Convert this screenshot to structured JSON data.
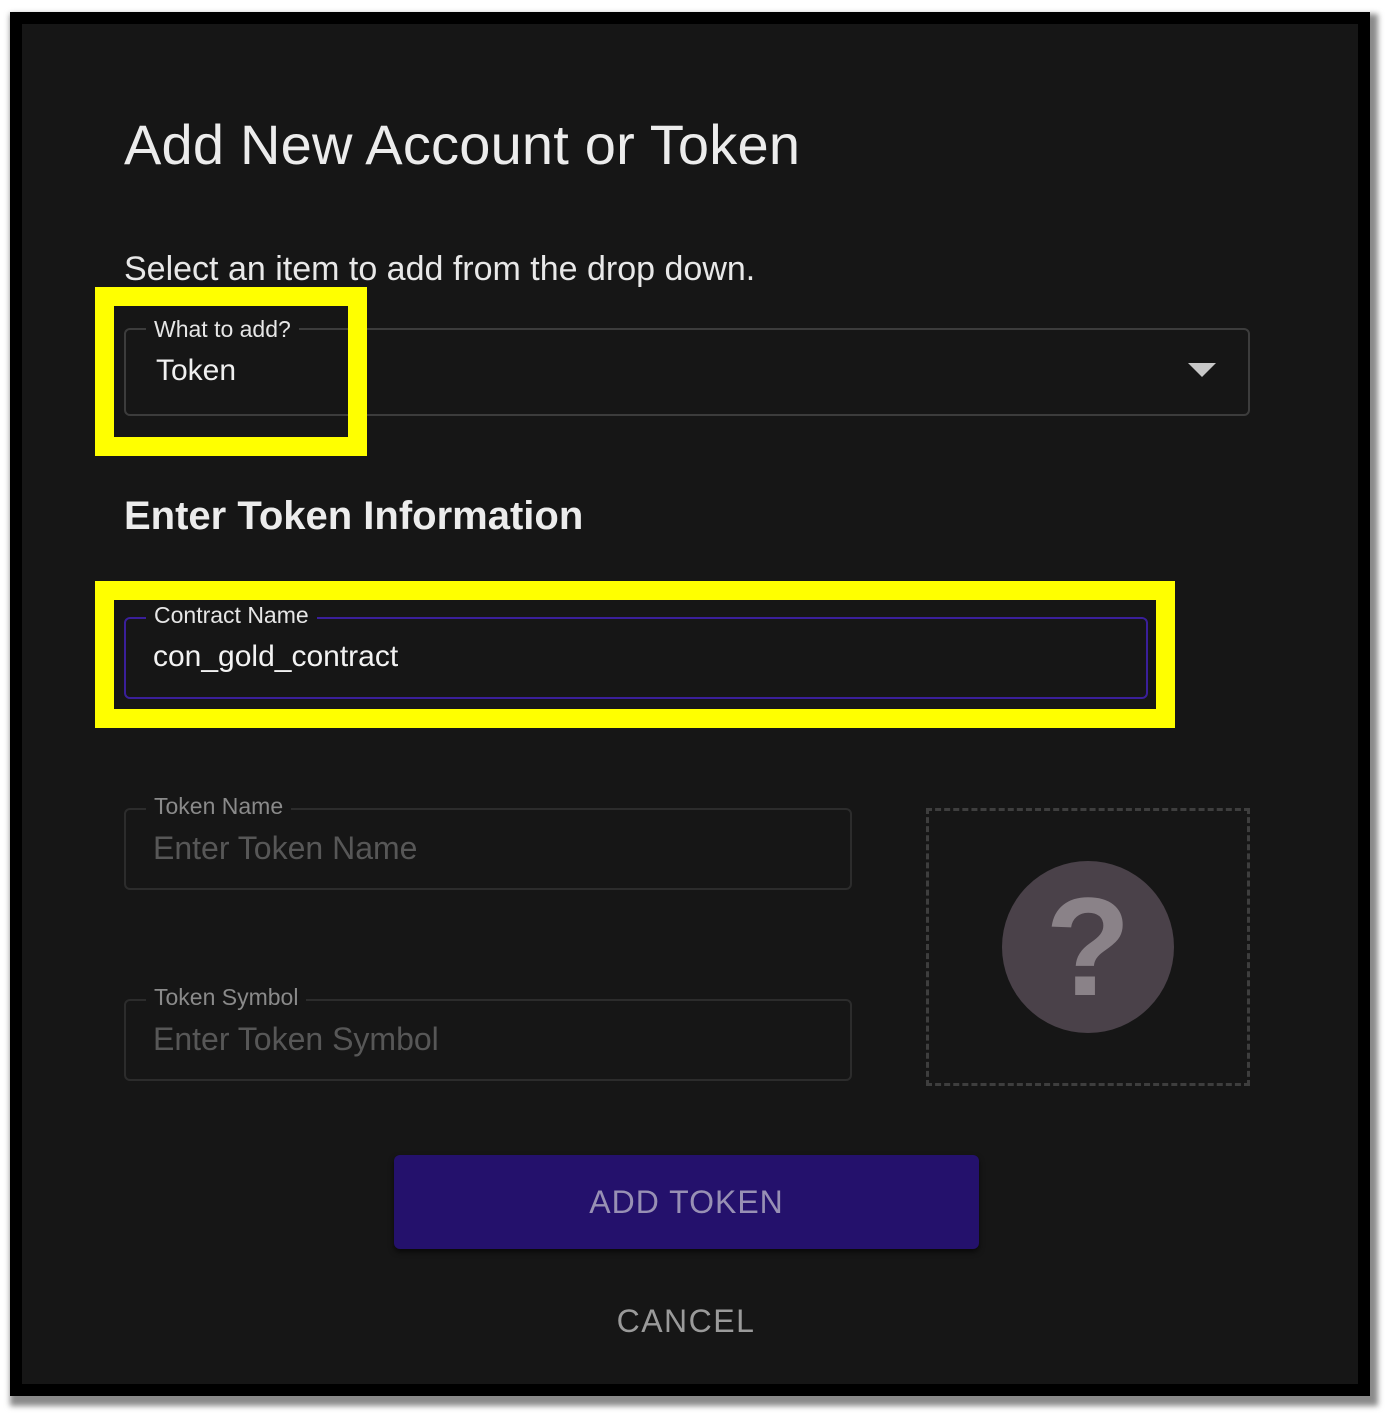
{
  "dialog": {
    "title": "Add New Account or Token",
    "instruction": "Select an item to add from the drop down."
  },
  "type_select": {
    "label": "What to add?",
    "value": "Token"
  },
  "section": {
    "heading": "Enter Token Information"
  },
  "contract_name": {
    "label": "Contract Name",
    "value": "con_gold_contract"
  },
  "token_name": {
    "label": "Token Name",
    "placeholder": "Enter Token Name"
  },
  "token_symbol": {
    "label": "Token Symbol",
    "placeholder": "Enter Token Symbol"
  },
  "logo_placeholder": {
    "icon": "question-mark-icon",
    "glyph": "?"
  },
  "actions": {
    "add_label": "ADD TOKEN",
    "cancel_label": "CANCEL"
  },
  "colors": {
    "highlight": "#ffff00",
    "primary": "#24116c",
    "focus_border": "#3a1f9a",
    "background": "#161616"
  }
}
